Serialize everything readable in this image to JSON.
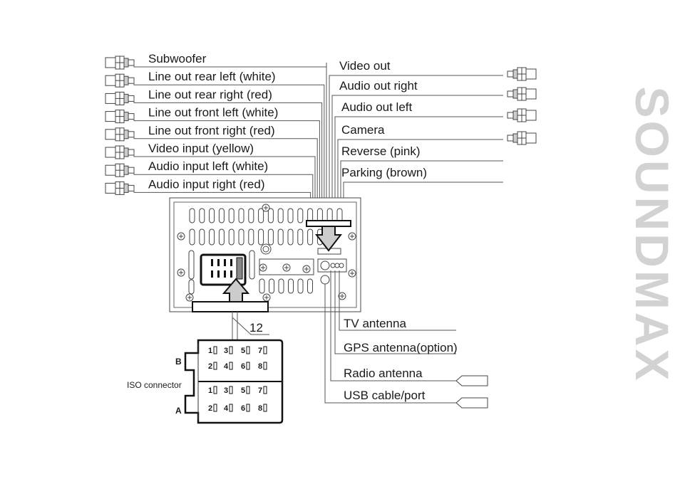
{
  "brand": {
    "name": "SOUNDMAX",
    "color": "#d2d2d2"
  },
  "left_outputs": [
    {
      "label": "Subwoofer"
    },
    {
      "label": "Line out rear left (white)"
    },
    {
      "label": "Line out rear right (red)"
    },
    {
      "label": "Line out front left (white)"
    },
    {
      "label": "Line out front right (red)"
    },
    {
      "label": "Video input (yellow)"
    },
    {
      "label": "Audio input left (white)"
    },
    {
      "label": "Audio input right (red)"
    }
  ],
  "right_outputs": [
    {
      "label": "Video out",
      "connector": "rca"
    },
    {
      "label": "Audio out right",
      "connector": "rca"
    },
    {
      "label": "Audio out left",
      "connector": "rca"
    },
    {
      "label": "Camera",
      "connector": "rca"
    },
    {
      "label": "Reverse (pink)",
      "connector": "wire"
    },
    {
      "label": "Parking (brown)",
      "connector": "wire"
    }
  ],
  "bottom_outputs": [
    {
      "label": "TV antenna",
      "connector": "wire"
    },
    {
      "label": "GPS antenna(option)",
      "connector": "wire"
    },
    {
      "label": "Radio antenna",
      "connector": "plug"
    },
    {
      "label": "USB cable/port",
      "connector": "plug"
    }
  ],
  "iso": {
    "callout": "12",
    "label": "ISO connector",
    "block_b": "B",
    "block_a": "A",
    "pins_top_row": [
      "1",
      "3",
      "5",
      "7"
    ],
    "pins_bottom_row": [
      "2",
      "4",
      "6",
      "8"
    ]
  }
}
